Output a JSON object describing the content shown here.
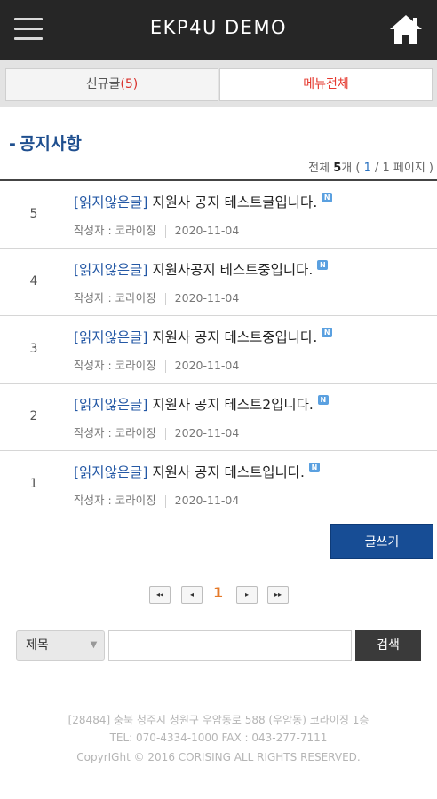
{
  "header": {
    "title": "EKP4U DEMO",
    "menu_icon": "hamburger-menu-icon",
    "home_icon": "home-icon",
    "bg_color": "#262626"
  },
  "tabs": {
    "new_label": "신규글",
    "new_count": "(5)",
    "all_menu_label": "메뉴전체",
    "accent_color": "#e5392f"
  },
  "section": {
    "dash": "-",
    "title": "공지사항",
    "summary_prefix": "전체",
    "summary_count": "5",
    "summary_unit": "개 (",
    "summary_page_current": "1",
    "summary_page_rest": "/ 1 페이지 )"
  },
  "posts": [
    {
      "num": "5",
      "tag": "[읽지않은글]",
      "title": "지원사 공지 테스트글입니다.",
      "badge": "N",
      "author": "작성자 : 코라이징",
      "date": "2020-11-04"
    },
    {
      "num": "4",
      "tag": "[읽지않은글]",
      "title": "지원사공지 테스트중입니다.",
      "badge": "N",
      "author": "작성자 : 코라이징",
      "date": "2020-11-04"
    },
    {
      "num": "3",
      "tag": "[읽지않은글]",
      "title": "지원사 공지 테스트중입니다.",
      "badge": "N",
      "author": "작성자 : 코라이징",
      "date": "2020-11-04"
    },
    {
      "num": "2",
      "tag": "[읽지않은글]",
      "title": "지원사 공지 테스트2입니다.",
      "badge": "N",
      "author": "작성자 : 코라이징",
      "date": "2020-11-04"
    },
    {
      "num": "1",
      "tag": "[읽지않은글]",
      "title": "지원사 공지 테스트입니다.",
      "badge": "N",
      "author": "작성자 : 코라이징",
      "date": "2020-11-04"
    }
  ],
  "write_button": "글쓰기",
  "pagination": {
    "first": "◂◂",
    "prev": "◂",
    "current": "1",
    "next": "▸",
    "last": "▸▸"
  },
  "search": {
    "field_selected": "제목",
    "caret": "▼",
    "input_value": "",
    "button": "검색"
  },
  "footer": {
    "address": "[28484] 충북 청주시 청원구 우암동로 588 (우암동) 코라이징 1층",
    "contact": "TEL: 070-4334-1000    FAX : 043-277-7111",
    "copyright": "CopyrIGht © 2016 CORISING ALL RIGHTS RESERVED."
  }
}
